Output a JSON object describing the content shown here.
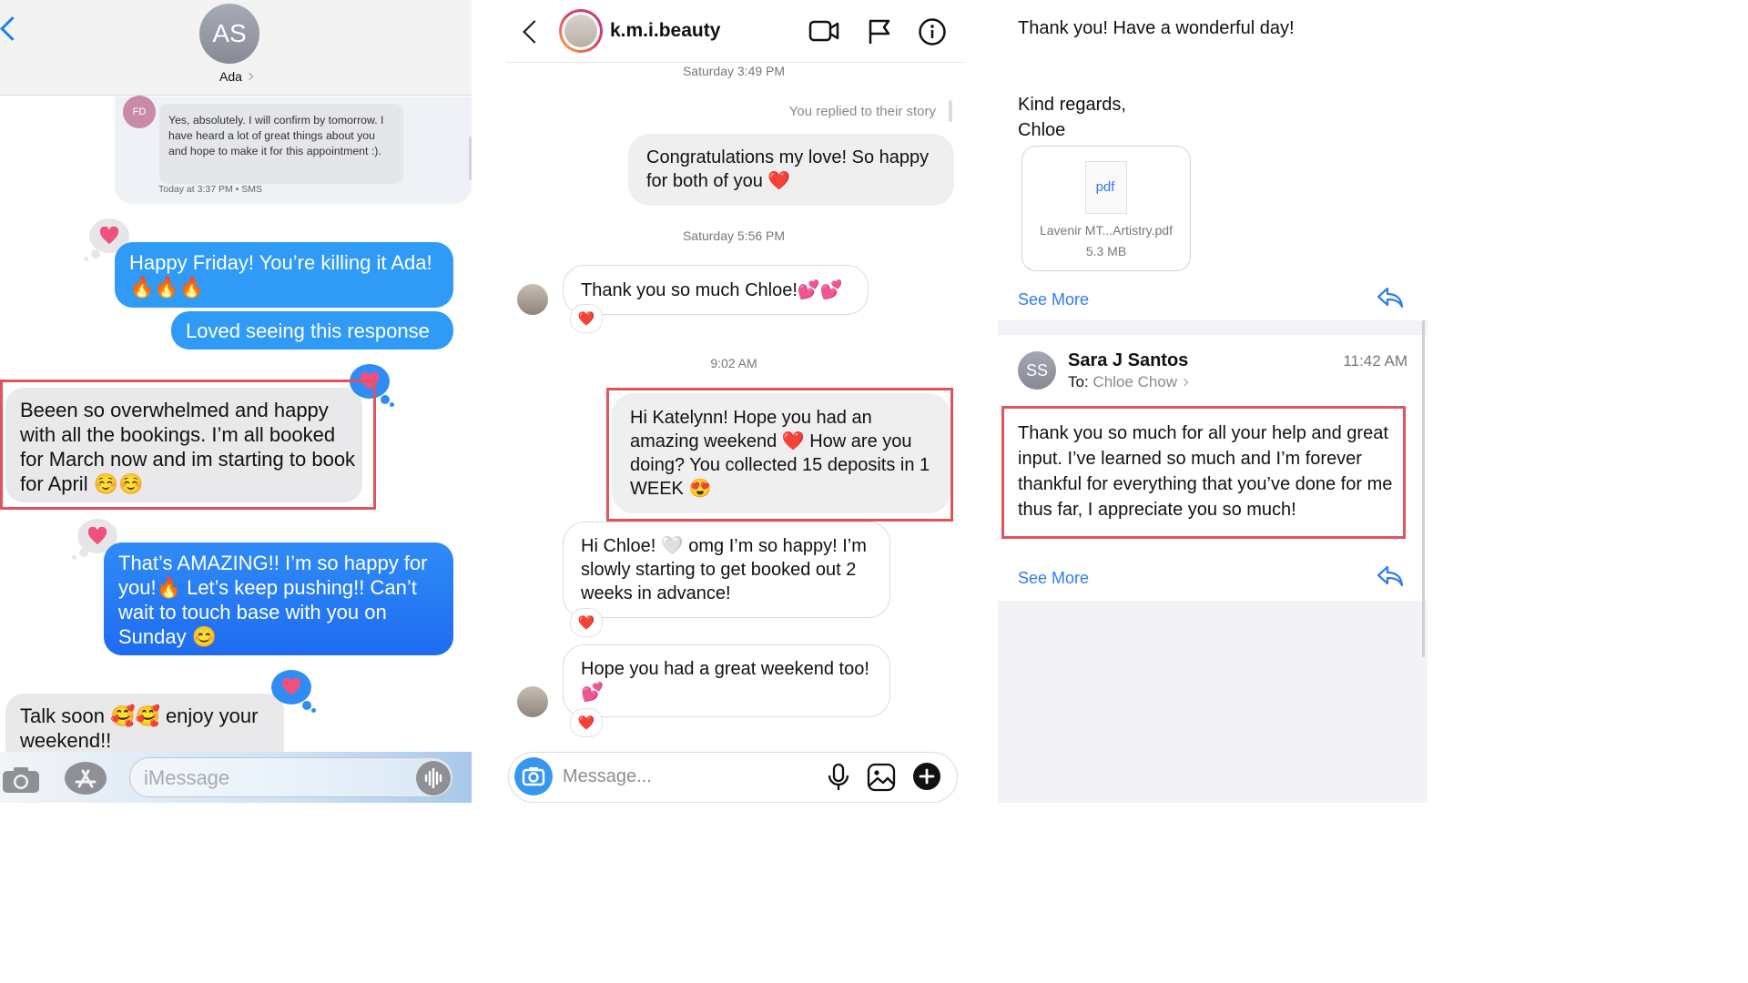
{
  "imessage": {
    "contact_initials": "AS",
    "contact_name": "Ada",
    "sms": {
      "sender_initials": "FD",
      "text": "Yes, absolutely. I will confirm by tomorrow. I have heard a lot of great things about you and hope to make it for this appointment :).",
      "timestamp": "Today at 3:37 PM • SMS"
    },
    "messages": [
      {
        "from": "me",
        "text": "Happy Friday! You’re killing it Ada! 🔥🔥🔥"
      },
      {
        "from": "me",
        "text": "Loved seeing this response"
      },
      {
        "from": "them",
        "text": "Beeen so overwhelmed and happy with all the bookings. I’m all booked for March now and im starting to book for April ☺️☺️"
      },
      {
        "from": "me",
        "text": "That’s AMAZING!! I’m so happy for you!🔥 Let’s keep pushing!! Can’t wait to touch base with you on Sunday 😊"
      },
      {
        "from": "them",
        "text": "Talk soon 🥰🥰 enjoy your weekend!!"
      }
    ],
    "tapback_icon": "heart-icon",
    "input_placeholder": "iMessage"
  },
  "instagram": {
    "username": "k.m.i.beauty",
    "header_icons": [
      "video-camera-icon",
      "flag-icon",
      "info-icon"
    ],
    "stamp_1": "Saturday 3:49 PM",
    "story_reply": "You replied to their story",
    "msg_1": "Congratulations my love! So happy for both of you ❤️",
    "stamp_2": "Saturday 5:56 PM",
    "msg_2": "Thank you so much Chloe!💕💕",
    "stamp_3": "9:02 AM",
    "msg_3": "Hi Katelynn! Hope you had an amazing weekend ❤️ How are you doing? You collected 15 deposits in 1 WEEK 😍",
    "msg_4": "Hi Chloe! 🤍 omg I’m so happy! I’m slowly starting to get booked out 2 weeks in advance!",
    "msg_5": "Hope you had a great weekend too! 💕",
    "reaction": "❤️",
    "input_placeholder": "Message..."
  },
  "mail": {
    "line_1": "Thank you! Have a wonderful day!",
    "line_2": "Kind regards,",
    "line_3": "Chloe",
    "attachment": {
      "type": "pdf",
      "name": "Lavenir MT...Artistry.pdf",
      "size": "5.3 MB"
    },
    "see_more": "See More",
    "sender_initials": "SS",
    "sender": "Sara J Santos",
    "time": "11:42 AM",
    "to_label": "To:",
    "to_name": "Chloe Chow",
    "body": "Thank you so much for all your help and great input. I’ve learned so much and I’m forever thankful for everything that you’ve done for me thus far, I appreciate you so much!"
  },
  "colors": {
    "imessage_blue": "#2f9bf6",
    "highlight_red": "#e2525f",
    "link_blue": "#2e7cf6",
    "tapback_pink": "#f0507e"
  }
}
